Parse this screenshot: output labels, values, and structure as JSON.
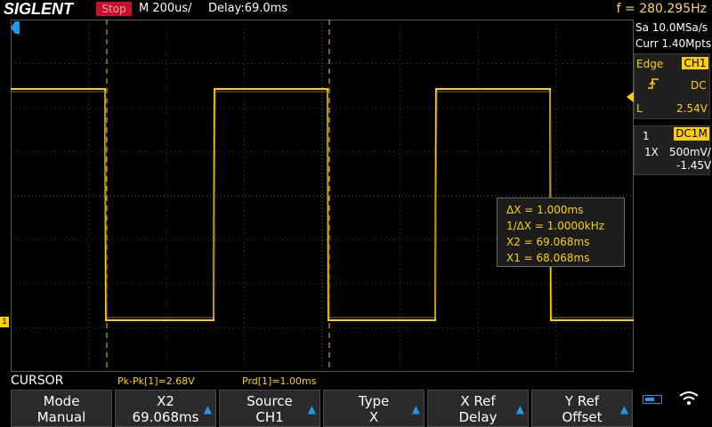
{
  "header": {
    "brand": "SIGLENT",
    "run_state": "Stop",
    "timebase": "M 200us/",
    "delay": "Delay:69.0ms",
    "frequency": "f = 280.295Hz"
  },
  "acquisition": {
    "sample_rate": "Sa 10.0MSa/s",
    "memory": "Curr 1.40Mpts"
  },
  "trigger": {
    "type": "Edge",
    "source": "CH1",
    "slope_icon": "rising-edge-icon",
    "coupling": "DC",
    "level_label": "L",
    "level": "2.54V"
  },
  "channel": {
    "number": "1",
    "coupling": "DC1M",
    "probe": "1X",
    "scale": "500mV/",
    "offset": "-1.45V",
    "marker": "1"
  },
  "cursor_readout": {
    "delta_x": "ΔX = 1.000ms",
    "inv_delta_x": "1/ΔX = 1.0000kHz",
    "x2": "X2 = 69.068ms",
    "x1": "X1 = 68.068ms"
  },
  "measurements": {
    "title": "CURSOR",
    "pk_pk": "Pk-Pk[1]=2.68V",
    "period": "Prd[1]=1.00ms"
  },
  "softkeys": [
    {
      "label": "Mode",
      "value": "Manual",
      "arrow": false
    },
    {
      "label": "X2",
      "value": "69.068ms",
      "arrow": true
    },
    {
      "label": "Source",
      "value": "CH1",
      "arrow": true
    },
    {
      "label": "Type",
      "value": "X",
      "arrow": true
    },
    {
      "label": "X Ref",
      "value": "Delay",
      "arrow": true
    },
    {
      "label": "Y Ref",
      "value": "Offset",
      "arrow": true
    }
  ],
  "colors": {
    "channel1": "#ffd000",
    "accent": "#1e9be8",
    "stop": "#c8102e"
  }
}
